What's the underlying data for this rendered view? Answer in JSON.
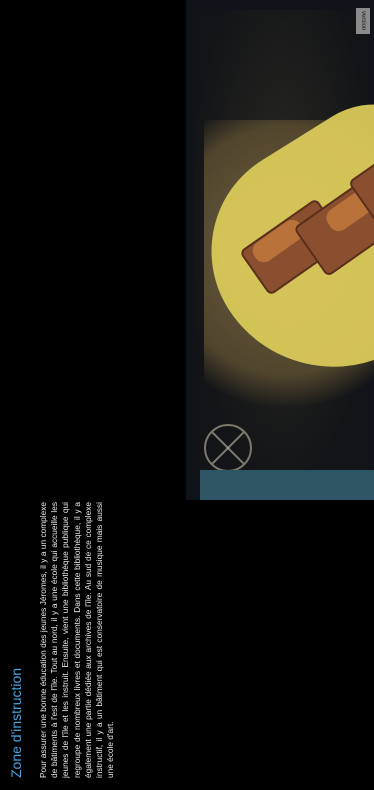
{
  "ui": {
    "version_label": "version",
    "sidebar": {
      "title": "Zone d'instruction",
      "body": "Pour assurer une bonne éducation des jeunes Jéromes, il y a un complexe de bâtiments à l'est de l'île. Tout au nord, il y a une école qui accueille les jeunes de l'île et les instruit. Ensuite, vient une bibliothèque publique qui regroupe de nombreux livres et documents. Dans cette bibliothèque, il y a également une partie dédiée aux archives de l'île. Au sud de ce complexe instructif, il y a un bâtiment qui est conservatoire de musique mais aussi une école d'art."
    },
    "icons": {
      "compass": "compass-rose-icon"
    },
    "colors": {
      "accent": "#4aa3df",
      "highlight": "#d9c95a",
      "strip": "#2e5563"
    }
  }
}
